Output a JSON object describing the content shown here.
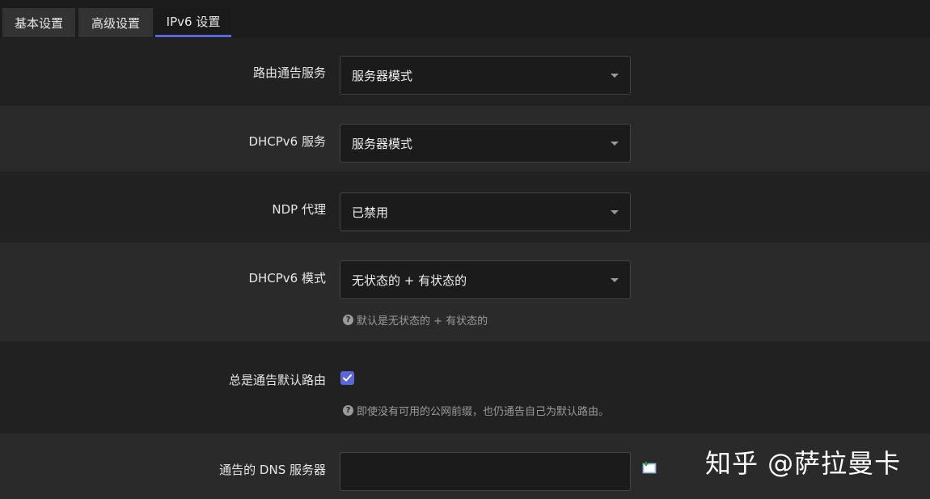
{
  "tabs": [
    {
      "label": "基本设置",
      "active": false
    },
    {
      "label": "高级设置",
      "active": false
    },
    {
      "label": "IPv6 设置",
      "active": true
    }
  ],
  "form": {
    "ra_service": {
      "label": "路由通告服务",
      "value": "服务器模式"
    },
    "dhcpv6_service": {
      "label": "DHCPv6 服务",
      "value": "服务器模式"
    },
    "ndp_proxy": {
      "label": "NDP 代理",
      "value": "已禁用"
    },
    "dhcpv6_mode": {
      "label": "DHCPv6 模式",
      "value": "无状态的 + 有状态的",
      "help": "默认是无状态的 + 有状态的"
    },
    "ra_default": {
      "label": "总是通告默认路由",
      "checked": true,
      "help": "即使没有可用的公网前缀，也仍通告自己为默认路由。"
    },
    "dns_servers": {
      "label": "通告的 DNS 服务器",
      "value": ""
    }
  },
  "watermark": "知乎 @萨拉曼卡",
  "colors": {
    "accent": "#5b67d6",
    "background": "#212121",
    "row_alt": "#2a2a2a"
  }
}
